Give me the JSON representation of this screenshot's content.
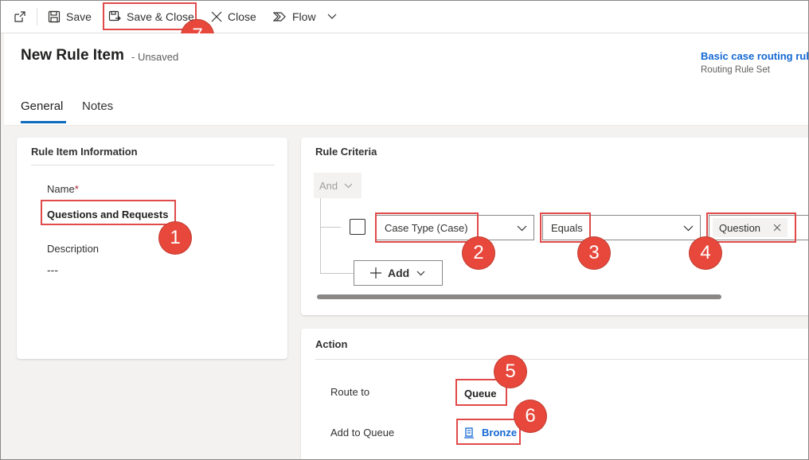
{
  "toolbar": {
    "save_label": "Save",
    "save_close_label": "Save & Close",
    "close_label": "Close",
    "flow_label": "Flow"
  },
  "header": {
    "title": "New Rule Item",
    "status": "- Unsaved",
    "parent_link": "Basic case routing rule",
    "parent_type": "Routing Rule Set"
  },
  "tabs": [
    {
      "label": "General",
      "active": true
    },
    {
      "label": "Notes",
      "active": false
    }
  ],
  "rule_item_info": {
    "section_title": "Rule Item Information",
    "name_label": "Name",
    "required_marker": "*",
    "name_value": "Questions and Requests",
    "description_label": "Description",
    "description_value": "---"
  },
  "rule_criteria": {
    "section_title": "Rule Criteria",
    "group_operator": "And",
    "condition": {
      "field": "Case Type (Case)",
      "operator": "Equals",
      "value": "Question"
    },
    "add_label": "Add"
  },
  "action": {
    "section_title": "Action",
    "route_to_label": "Route to",
    "route_to_value": "Queue",
    "add_to_queue_label": "Add to Queue",
    "add_to_queue_value": "Bronze"
  },
  "callouts": [
    "1",
    "2",
    "3",
    "4",
    "5",
    "6",
    "7"
  ],
  "colors": {
    "accent": "#0f6cbd",
    "link": "#1368d3",
    "callout": "#e8483c",
    "highlight_box": "#e04a4a"
  }
}
